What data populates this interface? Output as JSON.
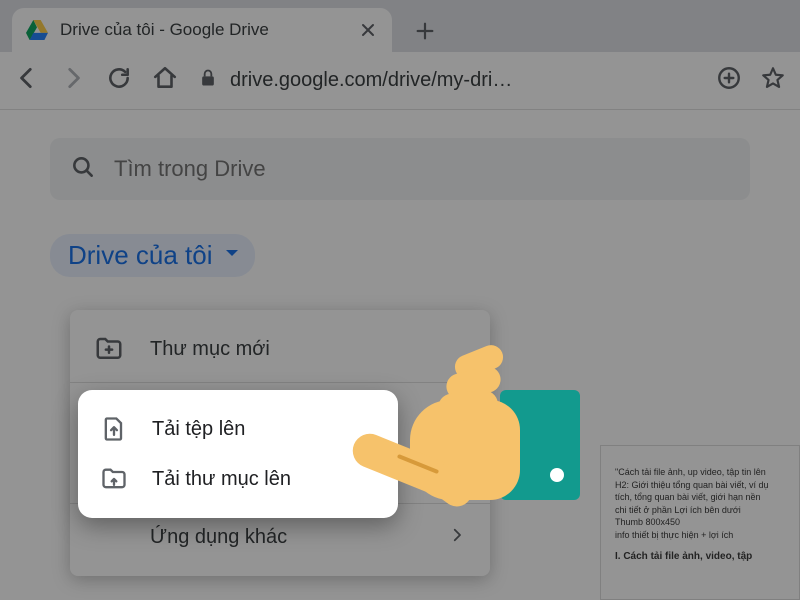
{
  "tab": {
    "title": "Drive của tôi - Google Drive"
  },
  "url": "drive.google.com/drive/my-dri…",
  "search": {
    "placeholder": "Tìm trong Drive"
  },
  "breadcrumb": {
    "label": "Drive của tôi"
  },
  "menu": {
    "new_folder": "Thư mục mới",
    "upload_file": "Tải tệp lên",
    "upload_folder": "Tải thư mục lên",
    "more_apps": "Ứng dụng khác"
  },
  "doc_preview": {
    "l1": "\"Cách tải file ảnh, up video, tập tin lên",
    "l2": "H2: Giới thiệu tổng quan bài viết, ví dụ",
    "l3": "tích, tổng quan bài viết, giới hạn nền",
    "l4": "chi tiết ở phần Lợi ích bên dưới",
    "l5": "Thumb 800x450",
    "l6": "info thiết bị thực hiện + lợi ích",
    "heading": "I. Cách tải file ảnh, video, tập"
  }
}
